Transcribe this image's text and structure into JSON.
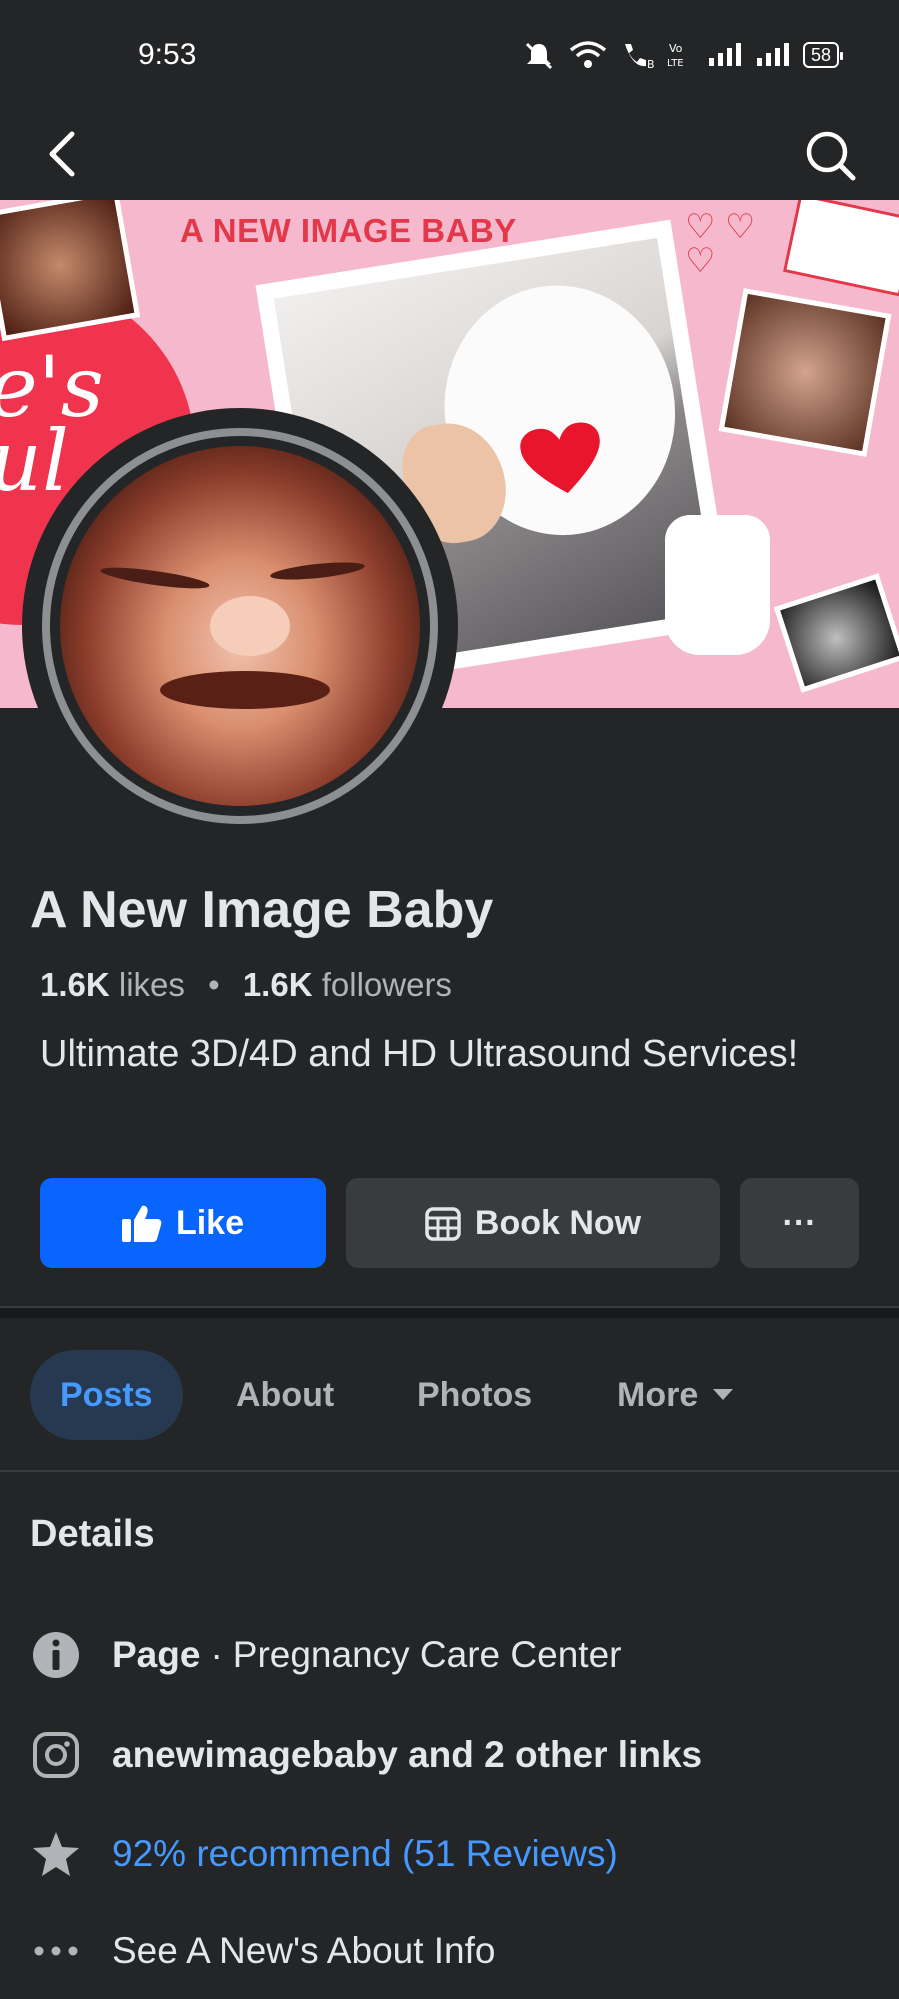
{
  "status_bar": {
    "time": "9:53",
    "battery": "58",
    "icons": [
      "mute-icon",
      "wifi-icon",
      "wifi-calling-icon",
      "volte-icon",
      "signal-icon",
      "signal-icon",
      "battery-icon"
    ]
  },
  "nav": {
    "back_icon": "chevron-left-icon",
    "search_icon": "search-icon"
  },
  "cover": {
    "title": "A NEW IMAGE BABY",
    "script_text": "e's\nul"
  },
  "page": {
    "name": "A New Image Baby",
    "likes_count": "1.6K",
    "likes_label": "likes",
    "separator": "•",
    "followers_count": "1.6K",
    "followers_label": "followers",
    "description": "Ultimate 3D/4D and HD Ultrasound Services!"
  },
  "actions": {
    "like_label": "Like",
    "book_label": "Book Now",
    "more_label": "···"
  },
  "tabs": [
    {
      "label": "Posts",
      "active": true
    },
    {
      "label": "About",
      "active": false
    },
    {
      "label": "Photos",
      "active": false
    },
    {
      "label": "More",
      "active": false
    }
  ],
  "details": {
    "heading": "Details",
    "category_prefix": "Page",
    "category_separator": "·",
    "category": "Pregnancy Care Center",
    "links": "anewimagebaby and 2 other links",
    "reviews": "92% recommend (51 Reviews)",
    "about_info": "See A New's About Info"
  },
  "colors": {
    "background": "#242526",
    "accent_blue": "#0866ff",
    "link_blue": "#4599ff",
    "cover_pink": "#f5b8cc"
  }
}
